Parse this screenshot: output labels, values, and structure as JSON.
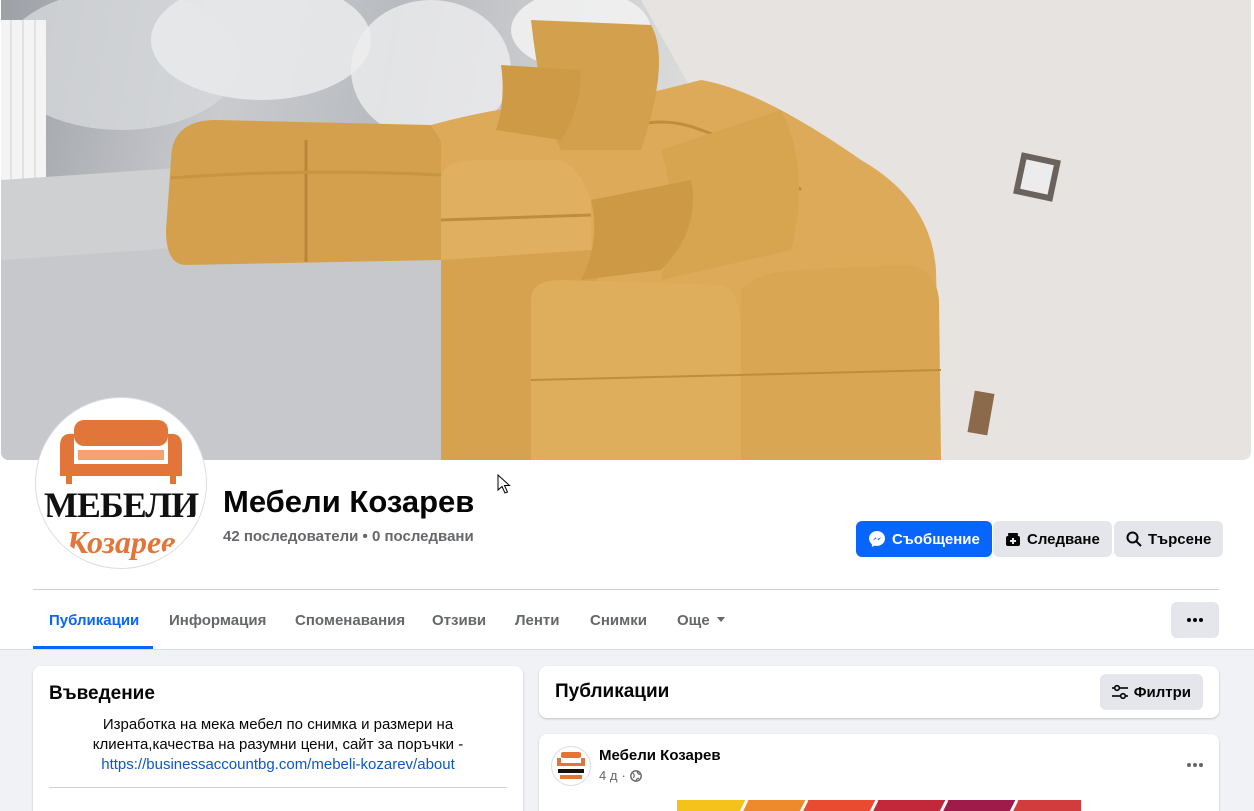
{
  "page": {
    "name": "Мебели Козарев",
    "followers_line": "42 последователи • 0 последвани"
  },
  "avatar": {
    "logo_line1": "МЕБЕЛИ",
    "logo_line2": "Козарев"
  },
  "actions": {
    "message_label": "Съобщение",
    "follow_label": "Следване",
    "search_label": "Търсене",
    "message_icon": "messenger-icon",
    "follow_icon": "follow-icon",
    "search_icon": "search-icon"
  },
  "tabs": [
    {
      "label": "Публикации",
      "active": true
    },
    {
      "label": "Информация",
      "active": false
    },
    {
      "label": "Споменавания",
      "active": false
    },
    {
      "label": "Отзиви",
      "active": false
    },
    {
      "label": "Ленти",
      "active": false
    },
    {
      "label": "Снимки",
      "active": false
    },
    {
      "label": "Още",
      "active": false
    }
  ],
  "intro": {
    "title": "Въведение",
    "description": "Изработка на мека мебел по снимка и размери на клиента,качества на разумни цени, сайт за поръчки -",
    "link": "https://businessaccountbg.com/mebeli-kozarev/about"
  },
  "posts": {
    "title": "Публикации",
    "filters_label": "Филтри"
  },
  "post": {
    "author": "Мебели Козарев",
    "time": "4 д",
    "audience_icon": "globe-icon"
  },
  "colors": {
    "accent": "#0866ff",
    "brand_orange": "#e2763a",
    "sofa": "#d9a450"
  }
}
